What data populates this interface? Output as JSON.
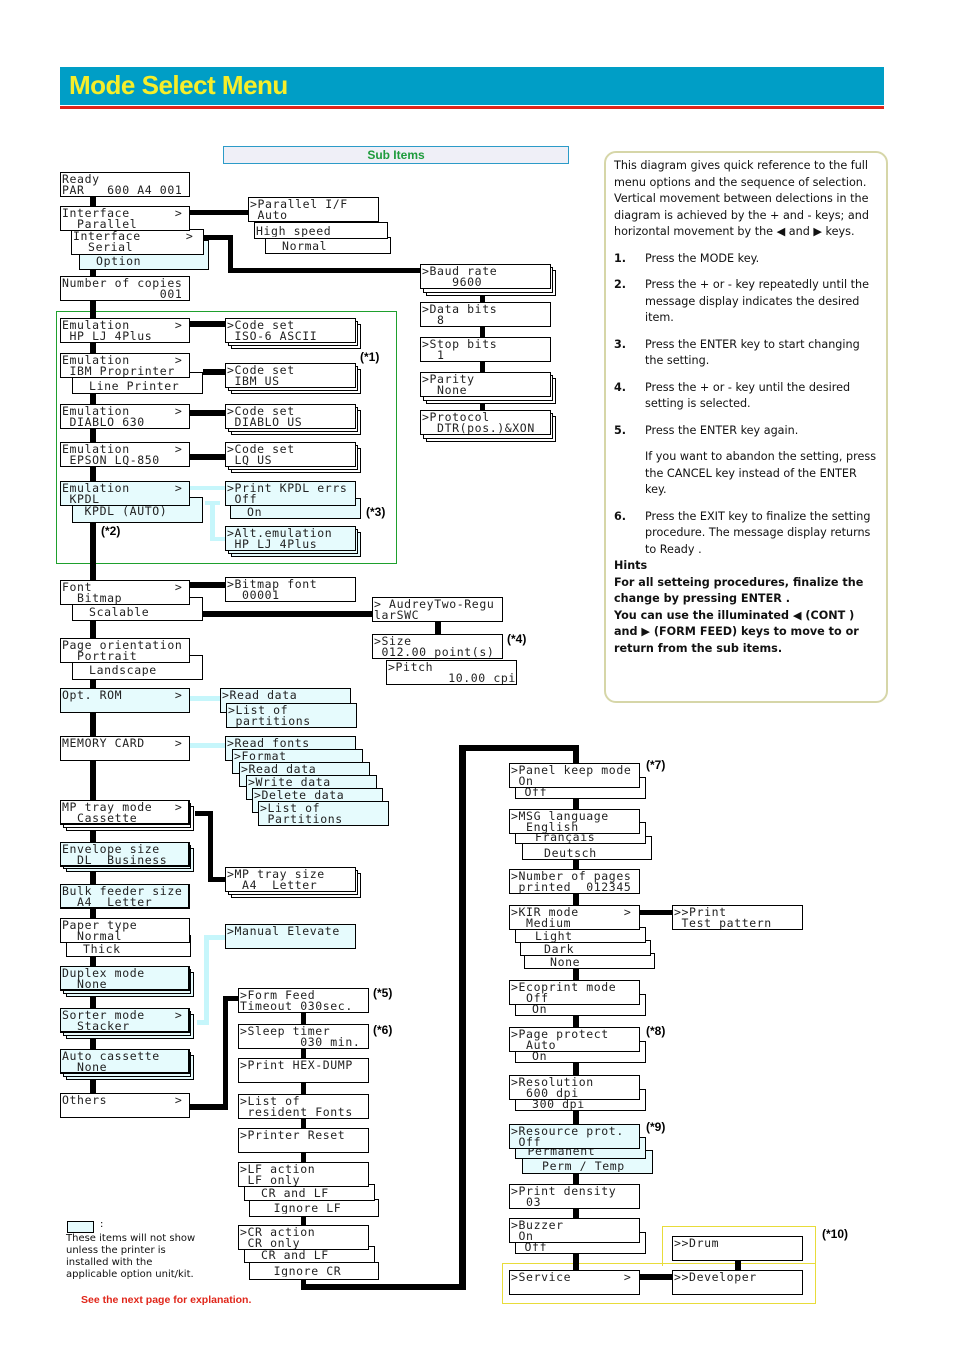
{
  "page": {
    "title": "Mode Select Menu",
    "sub_items_label": "Sub Items",
    "colors": {
      "title_bar": "#009ec6",
      "title_text": "#f6ee2a",
      "rule": "#e0261a",
      "option_fill": "#e6fbfd",
      "sub_items_text": "#1e9b3c"
    }
  },
  "main_menu": {
    "ready": [
      "Ready",
      "PAR   600 A4 001"
    ],
    "interface_parallel": [
      "Interface      >",
      "  Parallel"
    ],
    "interface_serial": [
      "Interface      >",
      "  Serial"
    ],
    "interface_option": "  Option",
    "copies": [
      "Number of copies",
      "             001"
    ],
    "emul_hp": [
      "Emulation      >",
      " HP LJ 4Plus"
    ],
    "emul_ibm": [
      "Emulation      >",
      " IBM Proprinter"
    ],
    "emul_line": "  Line Printer",
    "emul_diablo": [
      "Emulation      >",
      " DIABLO 630"
    ],
    "emul_epson": [
      "Emulation      >",
      " EPSON LQ-850"
    ],
    "emul_kpdl": [
      "Emulation      >",
      " KPDL"
    ],
    "emul_kpdl_auto": " KPDL (AUTO)",
    "font_bitmap": [
      "Font           >",
      "  Bitmap"
    ],
    "font_scalable": "  Scalable",
    "orient": [
      "Page orientation",
      "  Portrait"
    ],
    "orient_land": "  Landscape",
    "opt_rom": [
      "Opt. ROM       >",
      ""
    ],
    "memcard": [
      "MEMORY CARD    >",
      ""
    ],
    "mp_tray": [
      "MP tray mode   >",
      "  Cassette"
    ],
    "envelope": [
      "Envelope size",
      "  DL  Business"
    ],
    "bulk": [
      "Bulk feeder size",
      "  A4  Letter"
    ],
    "paper": [
      "Paper type",
      "  Normal"
    ],
    "paper_thick": "  Thick",
    "duplex": [
      "Duplex mode",
      "  None"
    ],
    "sorter": [
      "Sorter mode    >",
      "  Stacker"
    ],
    "autocass": [
      "Auto cassette",
      "  None"
    ],
    "others": [
      "Others         >",
      ""
    ]
  },
  "interface_sub": {
    "parallel": [
      ">Parallel I/F",
      " Auto"
    ],
    "high": "High speed",
    "normal": "  Normal",
    "baud": [
      ">Baud rate",
      "    9600"
    ],
    "data_bits": [
      ">Data bits",
      "  8"
    ],
    "stop_bits": [
      ">Stop bits",
      "  1"
    ],
    "parity": [
      ">Parity",
      "  None"
    ],
    "protocol": [
      ">Protocol",
      "  DTR(pos.)&XON"
    ]
  },
  "emulation_sub": {
    "hp_code": [
      ">Code set",
      " ISO-6 ASCII"
    ],
    "ibm_code": [
      ">Code set",
      " IBM US"
    ],
    "diablo_code": [
      ">Code set",
      " DIABLO US"
    ],
    "epson_code": [
      ">Code set",
      " LQ US"
    ],
    "kpdl_errs": [
      ">Print KPDL errs",
      " Off"
    ],
    "kpdl_on": "  On",
    "alt_emul": [
      ">Alt.emulation",
      " HP LJ 4Plus"
    ]
  },
  "font_sub": {
    "bitmap": [
      ">Bitmap font",
      "  00001"
    ],
    "scalable": [
      "> AudreyTwo-Regu",
      "larSWC"
    ],
    "size": [
      ">Size",
      " 012.00 point(s)"
    ],
    "pitch": [
      ">Pitch",
      "        10.00 cpi"
    ]
  },
  "optrom_sub": {
    "read": ">Read data",
    "list": [
      ">List of",
      " partitions"
    ]
  },
  "memcard_sub": {
    "read_fonts": ">Read fonts",
    "format": ">Format",
    "read_data": ">Read data",
    "write_data": ">Write data",
    "delete_data": ">Delete data",
    "list": [
      ">List of",
      " Partitions"
    ]
  },
  "tray_sub": {
    "mp_size": [
      ">MP tray size",
      "  A4  Letter"
    ],
    "manual": ">Manual Elevate"
  },
  "others_sub": {
    "formfeed": [
      ">Form Feed",
      "Timeout 030sec."
    ],
    "sleep": [
      ">Sleep timer",
      "        030 min."
    ],
    "hexdump": ">Print HEX-DUMP",
    "resident": [
      ">List of",
      " resident Fonts"
    ],
    "reset": ">Printer Reset",
    "lf": [
      ">LF action",
      " LF only"
    ],
    "lf_crlf": "  CR and LF",
    "lf_ignore": "   Ignore LF",
    "cr": [
      ">CR action",
      " CR only"
    ],
    "cr_crlf": "  CR and LF",
    "cr_ignore": "   Ignore CR",
    "panel": [
      ">Panel keep mode",
      " On"
    ],
    "panel_off": " Off",
    "msg": [
      ">MSG language",
      "  English"
    ],
    "msg_fr": "  Français",
    "msg_de": "  Deutsch",
    "pages": [
      ">Number of pages",
      " printed  012345"
    ],
    "kir": [
      ">KIR mode      >",
      "  Medium"
    ],
    "kir_light": "  Light",
    "kir_dark": "  Dark",
    "kir_none": "  None",
    "test": [
      ">>Print",
      " Test pattern"
    ],
    "eco": [
      ">Ecoprint mode",
      "  Off"
    ],
    "eco_on": "  On",
    "protect": [
      ">Page protect",
      "  Auto"
    ],
    "protect_on": "  On",
    "res": [
      ">Resolution",
      "  600 dpi"
    ],
    "res_300": "  300 dpi",
    "resprot": [
      ">Resource prot.",
      " Off"
    ],
    "resprot_perm": " Permanent",
    "resprot_pt": "  Perm / Temp",
    "density": [
      ">Print density",
      "  03"
    ],
    "buzzer": [
      ">Buzzer",
      " On"
    ],
    "buzzer_off": " Off",
    "service": ">Service       >",
    "drum": ">>Drum",
    "developer": ">>Developer"
  },
  "notes": {
    "n1": "(*1)",
    "n2": "(*2)",
    "n3": "(*3)",
    "n4": "(*4)",
    "n5": "(*5)",
    "n6": "(*6)",
    "n7": "(*7)",
    "n8": "(*8)",
    "n9": "(*9)",
    "n10": "(*10)"
  },
  "info": {
    "intro": "This diagram gives quick reference to the full menu options and the sequence of selection. Vertical movement between delections in the diagram is achieved by the + and - keys; and horizontal movement by the ◀ and ▶ keys.",
    "steps": [
      {
        "n": "1.",
        "text": "Press the MODE key."
      },
      {
        "n": "2.",
        "text": "Press the + or - key repeatedly until the message display indicates the desired item."
      },
      {
        "n": "3.",
        "text": "Press the ENTER key to start changing the setting."
      },
      {
        "n": "4.",
        "text": "Press the + or - key until the desired setting is selected."
      },
      {
        "n": "5.",
        "text": "Press the ENTER key again."
      },
      {
        "n": "",
        "text": "If you want to abandon the setting, press the CANCEL key instead of the ENTER key."
      },
      {
        "n": "6.",
        "text": "Press the EXIT key to finalize the setting procedure. The message display returns to Ready ."
      }
    ],
    "hints_title": "Hints",
    "hint1": "For all setteing procedures, finalize the change by pressing ENTER .",
    "hint2": "You can use the illuminated ◀ (CONT ) and ▶ (FORM FEED) keys to move to or return from the sub items."
  },
  "legend": {
    "colon": ":",
    "text": "These items will not show unless the printer is installed with the applicable option unit/kit.",
    "see_next": "See the next page for explanation."
  }
}
